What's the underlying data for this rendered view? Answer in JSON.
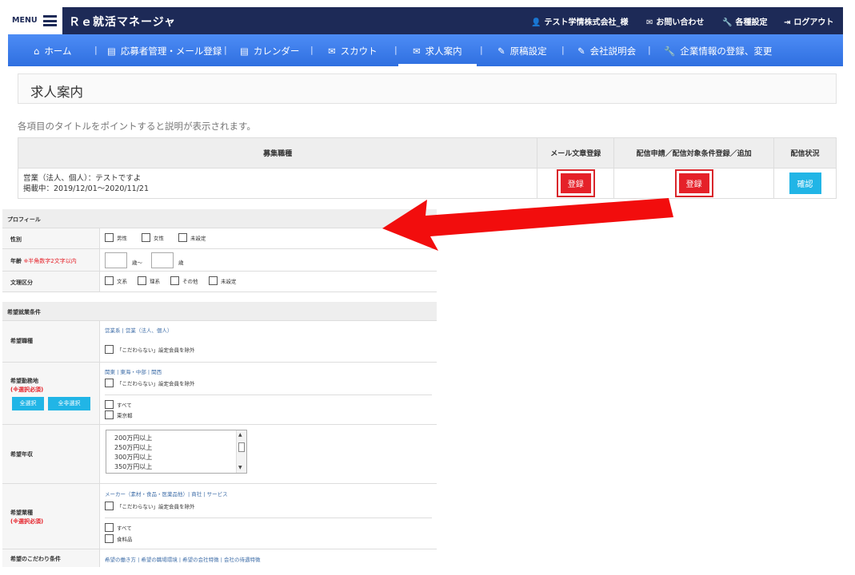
{
  "header": {
    "menu_label": "MENU",
    "app_title": "Ｒｅ就活マネージャ",
    "company": "テスト学情株式会社_様",
    "contact": "お問い合わせ",
    "settings": "各種設定",
    "logout": "ログアウト"
  },
  "nav": {
    "home": "ホーム",
    "applicants": "応募者管理・メール登録",
    "calendar": "カレンダー",
    "scout": "スカウト",
    "jobs": "求人案内",
    "manuscript": "原稿設定",
    "seminar": "会社説明会",
    "company_info": "企業情報の登録、変更"
  },
  "page": {
    "title": "求人案内",
    "hint": "各項目のタイトルをポイントすると説明が表示されます。"
  },
  "jobs_table": {
    "headers": [
      "募集職種",
      "メール文章登録",
      "配信申請／配信対象条件登録／追加",
      "配信状況"
    ],
    "row": {
      "job_line1": "営業（法人、個人）：テストですよ",
      "job_line2": "掲載中：2019/12/01～2020/11/21",
      "register1": "登録",
      "register2": "登録",
      "confirm": "確認"
    }
  },
  "profile": {
    "section": "プロフィール",
    "gender_label": "性別",
    "gender_options": [
      "男性",
      "女性",
      "未設定"
    ],
    "age_label": "年齢",
    "age_note": "※半角数字2文字以内",
    "age_from": "歳～",
    "age_to": "歳",
    "major_label": "文理区分",
    "major_options": [
      "文系",
      "理系",
      "その他",
      "未設定"
    ]
  },
  "conditions": {
    "section": "希望就業条件",
    "job_type_label": "希望職種",
    "job_type_links": "営業系 | 営業（法人、個人）",
    "exclude": "「こだわらない」設定会員を除外",
    "location_label": "希望勤務地",
    "required_note": "(※選択必須)",
    "select_all": "全選択",
    "deselect_all": "全非選択",
    "location_links": "関東 | 東海・中部 | 関西",
    "all": "すべて",
    "tokyo": "東京都",
    "salary_label": "希望年収",
    "salary_options": [
      "200万円以上",
      "250万円以上",
      "300万円以上",
      "350万円以上"
    ],
    "industry_label": "希望業種",
    "industry_links": "メーカー（素材・食品・医薬品他）| 商社 | サービス",
    "food": "食料品",
    "preference_label": "希望のこだわり条件",
    "preference_links": "希望の働き方 | 希望の職場環境 | 希望の会社特徴 | 会社の待遇特徴"
  }
}
